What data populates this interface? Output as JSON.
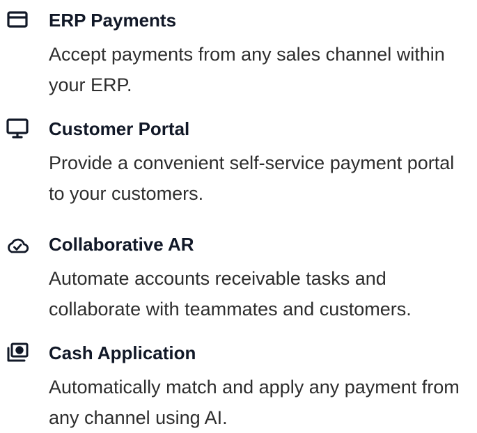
{
  "features": [
    {
      "icon": "credit-card-icon",
      "title": "ERP Payments",
      "description": "Accept payments from any sales channel within your ERP."
    },
    {
      "icon": "monitor-icon",
      "title": "Customer Portal",
      "description": "Provide a convenient self-service payment portal to your customers."
    },
    {
      "icon": "cloud-check-icon",
      "title": "Collaborative AR",
      "description": "Automate accounts receivable tasks and collaborate with teammates and customers."
    },
    {
      "icon": "cash-icon",
      "title": "Cash Application",
      "description": "Automatically match and apply any payment from any channel using AI."
    }
  ]
}
